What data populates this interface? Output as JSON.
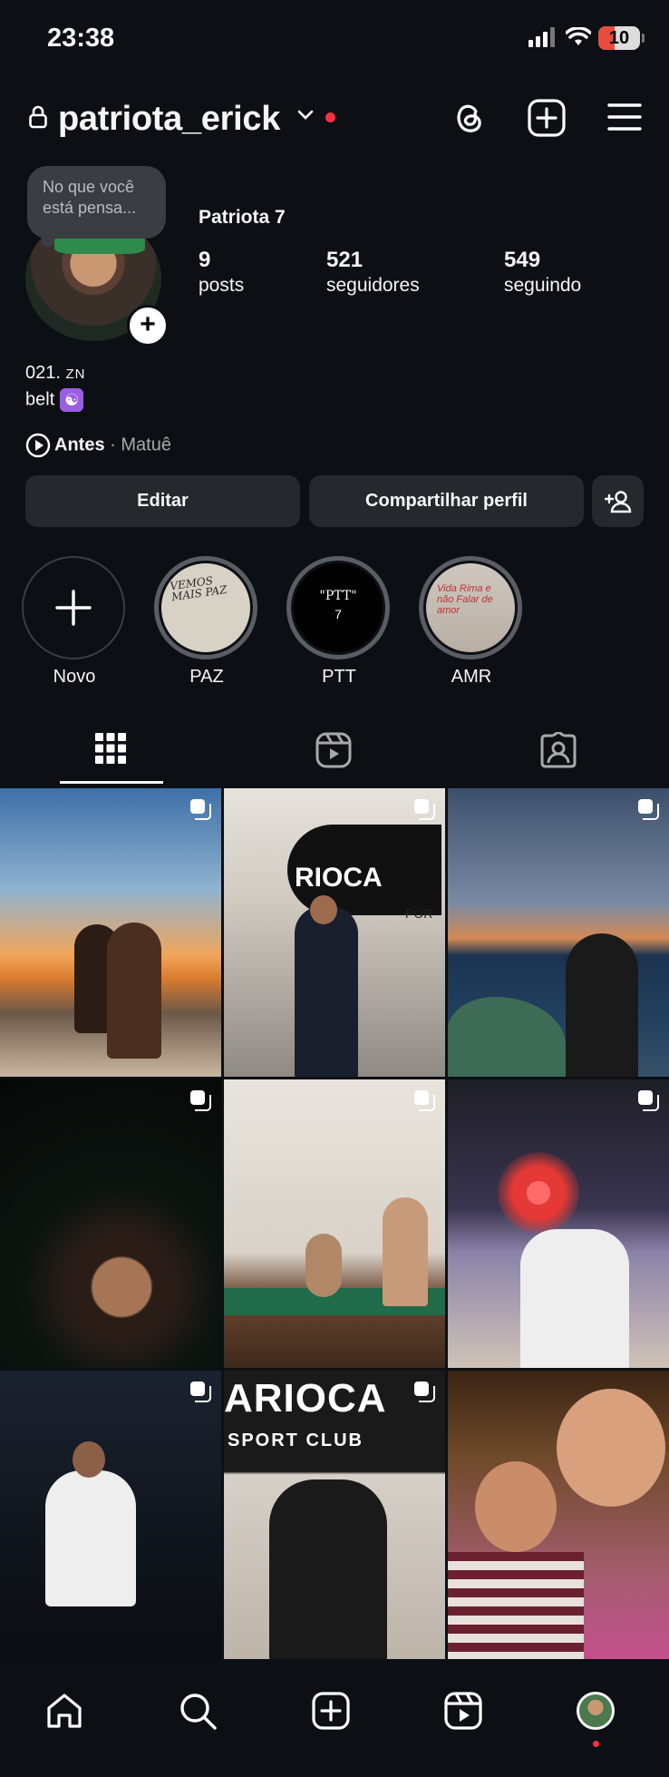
{
  "status_bar": {
    "time": "23:38",
    "battery": "10"
  },
  "header": {
    "username": "patriota_erick"
  },
  "profile": {
    "note_bubble": "No que você está pensa...",
    "display_name": "Patriota 7",
    "stats": [
      {
        "value": "9",
        "label": "posts"
      },
      {
        "value": "521",
        "label": "seguidores"
      },
      {
        "value": "549",
        "label": "seguindo"
      }
    ],
    "bio_line1_text": "021.",
    "bio_line1_small": "ZN",
    "bio_line2": "belt",
    "music": {
      "song": "Antes",
      "separator": "·",
      "artist": "Matuê"
    }
  },
  "actions": {
    "edit_label": "Editar",
    "share_label": "Compartilhar perfil"
  },
  "highlights": [
    {
      "label": "Novo"
    },
    {
      "label": "PAZ"
    },
    {
      "label": "PTT"
    },
    {
      "label": "AMR"
    }
  ],
  "highlight_art": {
    "paz_text": "VEMOS MAIS PAZ",
    "ptt_top": "\"PTT\"",
    "ptt_num": "7",
    "amr_text": "Vida Rima e não Falar de amor"
  },
  "grid_text": {
    "arioca": "ARIOCA",
    "sport_club": "SPORT CLUB",
    "sign_top": "RIOCA",
    "sign_sub": "POR"
  },
  "icons": {
    "lock": "lock-icon",
    "threads": "threads-icon",
    "create": "plus-square-icon",
    "menu": "menu-icon",
    "home": "home-icon",
    "search": "search-icon",
    "reels": "reels-icon"
  }
}
